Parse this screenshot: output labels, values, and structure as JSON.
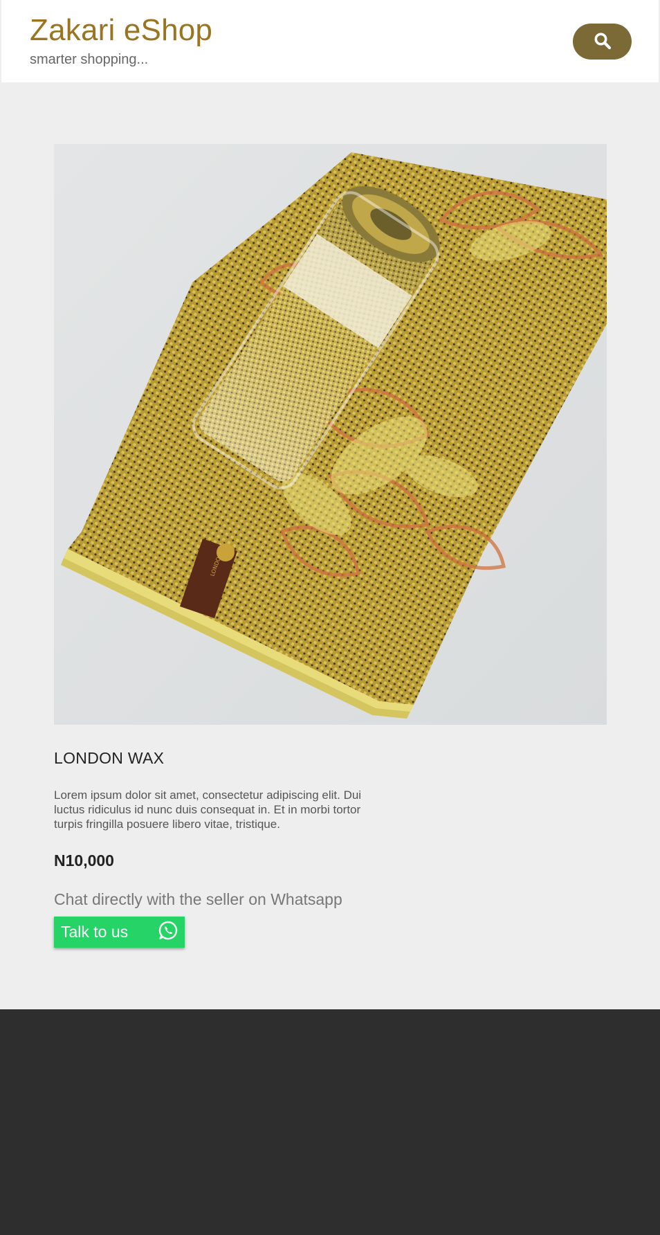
{
  "header": {
    "brand_title": "Zakari eShop",
    "brand_tagline": "smarter shopping...",
    "search_icon": "search-icon"
  },
  "product": {
    "image_icon": "product-photo-fabric-roll",
    "name": "LONDON WAX",
    "description": "Lorem ipsum dolor sit amet, consectetur adipiscing elit. Dui luctus ridiculus id nunc duis consequat in. Et in morbi tortor turpis fringilla posuere libero vitae, tristique.",
    "price": "N10,000"
  },
  "contact": {
    "prompt": "Chat directly with the seller on Whatsapp",
    "button_label": "Talk to us",
    "button_icon": "whatsapp-icon"
  },
  "colors": {
    "brand": "#9a7420",
    "search_button": "#7b6a35",
    "whatsapp_green": "#25d366",
    "footer": "#2e2e2f",
    "main_bg": "#efeeef"
  }
}
